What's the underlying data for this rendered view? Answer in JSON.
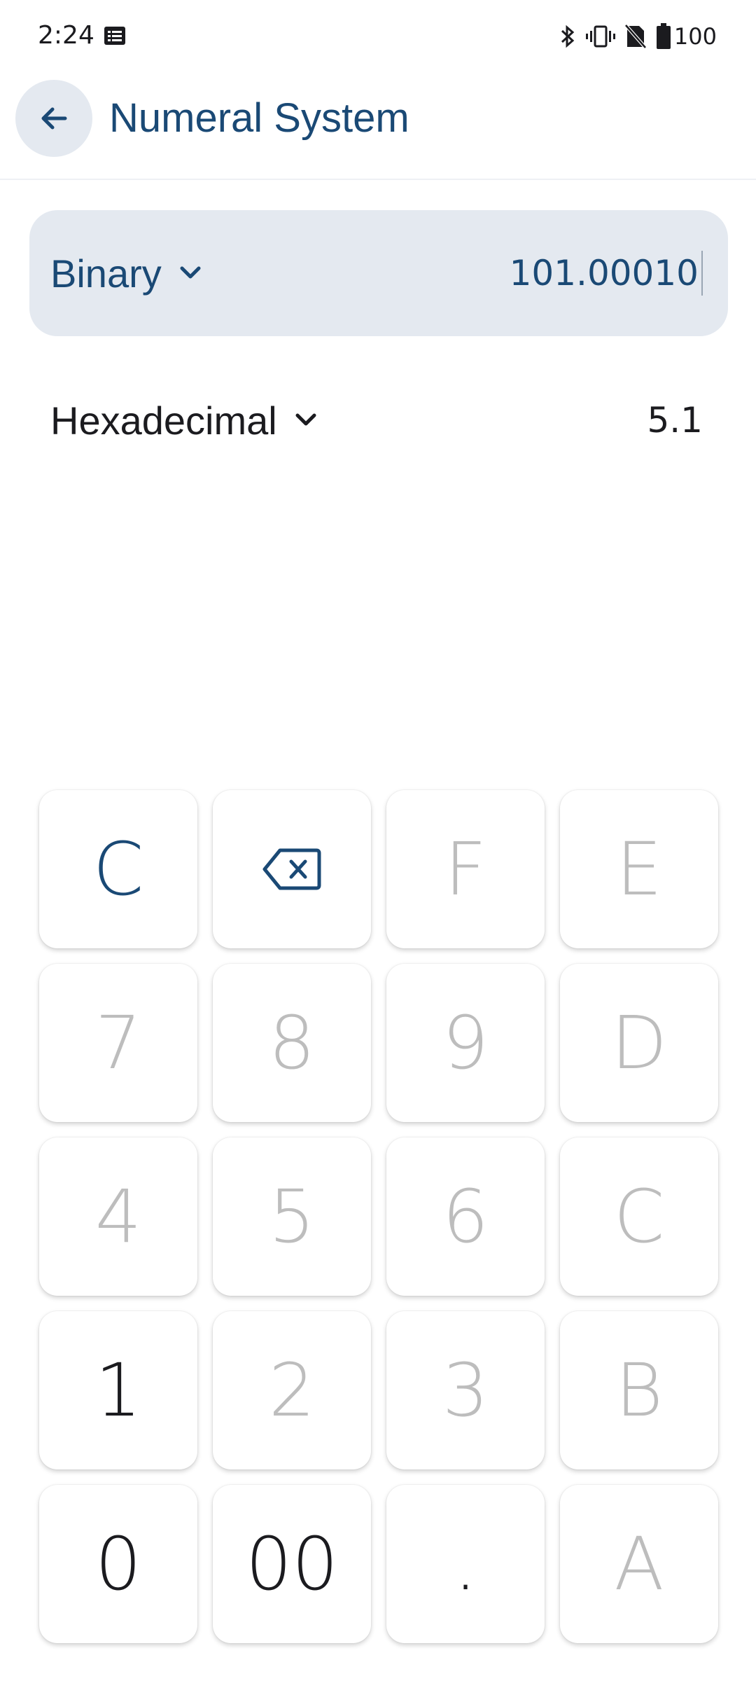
{
  "status_bar": {
    "time": "2:24",
    "battery": "100",
    "icons": [
      "notification-icon",
      "bluetooth-icon",
      "vibrate-icon",
      "no-sim-icon",
      "battery-icon"
    ]
  },
  "app_bar": {
    "title": "Numeral System",
    "back_icon": "arrow-back-icon"
  },
  "from_unit": {
    "name": "Binary",
    "value": "101.00010"
  },
  "to_unit": {
    "name": "Hexadecimal",
    "value": "5.1"
  },
  "colors": {
    "accent": "#1a4975",
    "active_row_bg": "#e4e9f0",
    "disabled_key_text": "#bdbdbd"
  },
  "keypad": {
    "clear": "C",
    "backspace_icon": "backspace-icon",
    "f": "F",
    "e": "E",
    "seven": "7",
    "eight": "8",
    "nine": "9",
    "d": "D",
    "four": "4",
    "five": "5",
    "six": "6",
    "c": "C",
    "one": "1",
    "two": "2",
    "three": "3",
    "b": "B",
    "zero": "0",
    "double_zero": "00",
    "dot": ".",
    "a": "A"
  }
}
